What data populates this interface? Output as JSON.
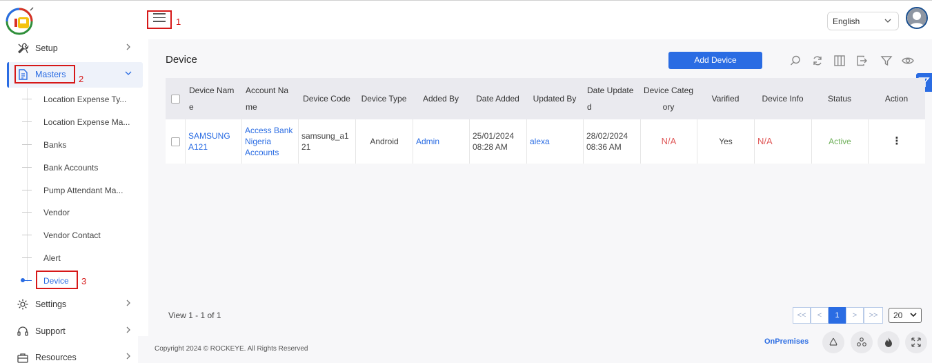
{
  "header": {
    "language": "English",
    "annotations": [
      "1",
      "2",
      "3"
    ]
  },
  "sidebar": {
    "setup": "Setup",
    "masters": "Masters",
    "sub_items": [
      "Location Expense Ty...",
      "Location Expense Ma...",
      "Banks",
      "Bank Accounts",
      "Pump Attendant Ma...",
      "Vendor",
      "Vendor Contact",
      "Alert",
      "Device"
    ],
    "settings": "Settings",
    "support": "Support",
    "resources": "Resources"
  },
  "page": {
    "title": "Device",
    "add_button": "Add Device"
  },
  "table": {
    "headers": [
      "Device Nam e",
      "Account Na me",
      "Device Code",
      "Device Type",
      "Added By",
      "Date Added",
      "Updated By",
      "Date Update d",
      "Device Categ ory",
      "Varified",
      "Device Info",
      "Status",
      "Action"
    ],
    "header_lines": {
      "device_name": [
        "Device Nam",
        "e"
      ],
      "account_name": [
        "Account Na",
        "me"
      ],
      "date_updated": [
        "Date Update",
        "d"
      ],
      "device_category": [
        "Device Categ",
        "ory"
      ]
    },
    "rows": [
      {
        "device_name": [
          "SAMSUNG",
          "A121"
        ],
        "account_name": [
          "Access Bank",
          "Nigeria",
          "Accounts"
        ],
        "device_code": [
          "samsung_a1",
          "21"
        ],
        "device_type": "Android",
        "added_by": "Admin",
        "date_added": [
          "25/01/2024",
          "08:28 AM"
        ],
        "updated_by": "alexa",
        "date_updated": [
          "28/02/2024",
          "08:36 AM"
        ],
        "device_category": "N/A",
        "varified": "Yes",
        "device_info": "N/A",
        "status": "Active",
        "action": "⋮"
      }
    ]
  },
  "pagination": {
    "view_info": "View 1 - 1 of 1",
    "first": "<<",
    "prev": "<",
    "current": "1",
    "next": ">",
    "last": ">>",
    "page_size": "20"
  },
  "footer": {
    "copyright": "Copyright 2024 © ROCKEYE. All Rights Reserved",
    "mode": "OnPremises"
  },
  "colors": {
    "primary": "#2a6ce3",
    "annotation": "#d61818",
    "na": "#e05a5a",
    "active": "#6fb05a"
  }
}
